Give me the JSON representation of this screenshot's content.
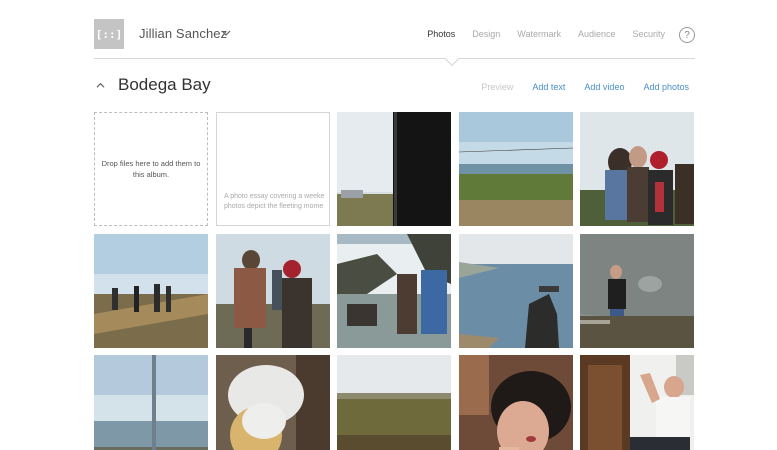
{
  "header": {
    "logo_text": "[::]",
    "user_name": "Jillian Sanchez",
    "nav": [
      {
        "label": "Photos",
        "active": true
      },
      {
        "label": "Design",
        "active": false
      },
      {
        "label": "Watermark",
        "active": false
      },
      {
        "label": "Audience",
        "active": false
      },
      {
        "label": "Security",
        "active": false
      }
    ],
    "help_label": "?"
  },
  "album": {
    "title": "Bodega Bay",
    "actions": [
      {
        "label": "Preview",
        "enabled": false
      },
      {
        "label": "Add text",
        "enabled": true
      },
      {
        "label": "Add video",
        "enabled": true
      },
      {
        "label": "Add photos",
        "enabled": true
      }
    ]
  },
  "grid": {
    "drop_zone_text": "Drop files here to add them to this album.",
    "essay_lines": [
      "A photo essay covering a weeke",
      "photos depict the fleeting mome"
    ]
  },
  "colors": {
    "accent": "#4a8ec8",
    "muted": "#aaaaaa",
    "border": "#d6d6d6"
  }
}
